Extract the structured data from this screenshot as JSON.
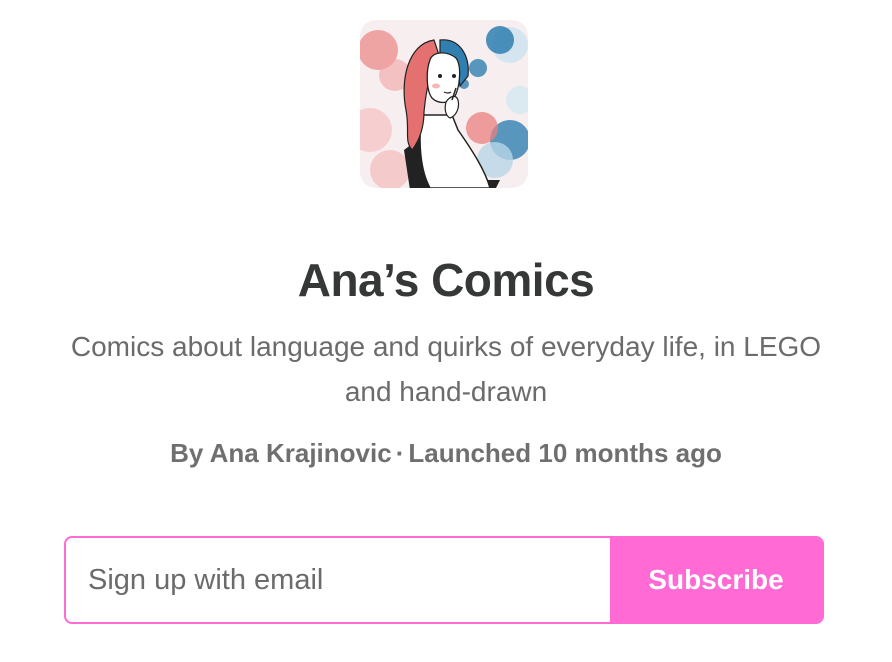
{
  "publication": {
    "name": "Ana’s Comics",
    "description": "Comics about language and quirks of everyday life, in LEGO and hand-drawn",
    "byline": {
      "author_prefix": "By Ana Krajinovic",
      "separator": "·",
      "launch_text": "Launched 10 months ago"
    }
  },
  "signup": {
    "email_placeholder": "Sign up with email",
    "email_value": "",
    "subscribe_label": "Subscribe"
  },
  "colors": {
    "accent": "#ff6ad5",
    "title": "#363737",
    "muted_text": "#6b6b6b"
  }
}
